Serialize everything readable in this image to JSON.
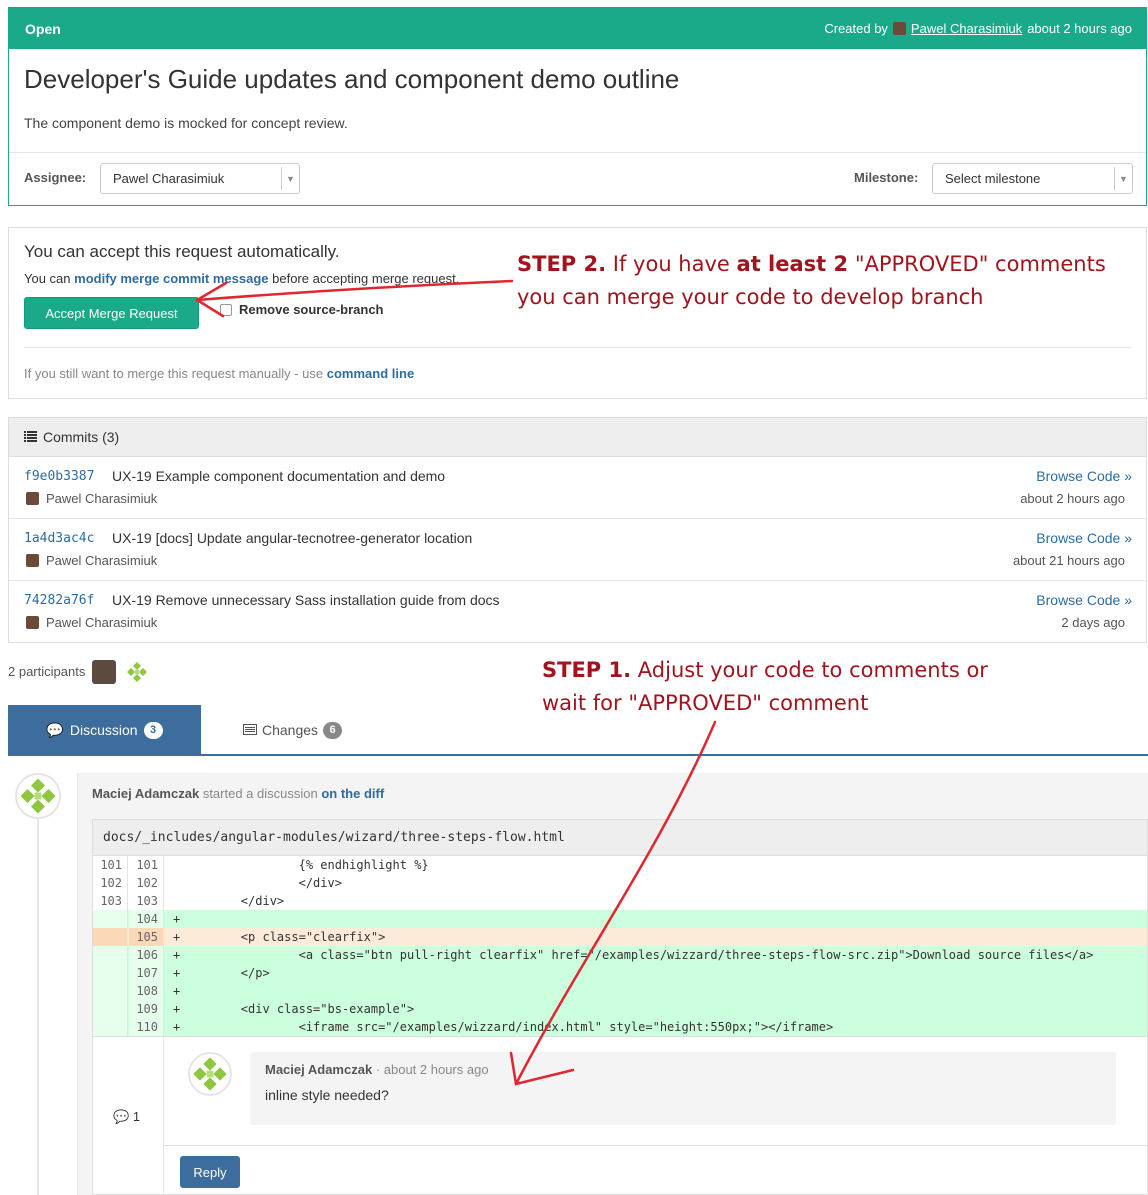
{
  "merge_request": {
    "state": "Open",
    "created_by_prefix": "Created by",
    "author": "Pawel Charasimiuk",
    "created_time": "about 2 hours ago",
    "title": "Developer's Guide updates and component demo outline",
    "description": "The component demo is mocked for concept review.",
    "assignee_label": "Assignee:",
    "assignee_value": "Pawel Charasimiuk",
    "milestone_label": "Milestone:",
    "milestone_value": "Select milestone"
  },
  "accept": {
    "title": "You can accept this request automatically.",
    "line_prefix": "You can",
    "line_link": "modify merge commit message",
    "line_suffix": "before accepting merge request.",
    "button": "Accept Merge Request",
    "remove_branch_label": "Remove source-branch",
    "manual_prefix": "If you still want to merge this request manually - use",
    "manual_link": "command line"
  },
  "commits": {
    "header": "Commits (3)",
    "items": [
      {
        "sha": "f9e0b3387",
        "message": "UX-19 Example component documentation and demo",
        "author": "Pawel Charasimiuk",
        "browse": "Browse Code »",
        "time": "about 2 hours ago"
      },
      {
        "sha": "1a4d3ac4c",
        "message": "UX-19 [docs] Update angular-tecnotree-generator location",
        "author": "Pawel Charasimiuk",
        "browse": "Browse Code »",
        "time": "about 21 hours ago"
      },
      {
        "sha": "74282a76f",
        "message": "UX-19 Remove unnecessary Sass installation guide from docs",
        "author": "Pawel Charasimiuk",
        "browse": "Browse Code »",
        "time": "2 days ago"
      }
    ]
  },
  "participants": "2 participants",
  "tabs": {
    "discussion_label": "Discussion",
    "discussion_count": "3",
    "changes_label": "Changes",
    "changes_count": "6"
  },
  "discussion": {
    "author": "Maciej Adamczak",
    "action": "started a discussion",
    "link": "on the diff",
    "file": "docs/_includes/angular-modules/wizard/three-steps-flow.html",
    "lines": [
      {
        "old": "101",
        "new": "101",
        "sign": "",
        "text": "                {% endhighlight %}",
        "kind": "ctx"
      },
      {
        "old": "102",
        "new": "102",
        "sign": "",
        "text": "                </div>",
        "kind": "ctx"
      },
      {
        "old": "103",
        "new": "103",
        "sign": "",
        "text": "        </div>",
        "kind": "ctx"
      },
      {
        "old": "",
        "new": "104",
        "sign": "+",
        "text": "",
        "kind": "add"
      },
      {
        "old": "",
        "new": "105",
        "sign": "+",
        "text": "        <p class=\"clearfix\">",
        "kind": "hl"
      },
      {
        "old": "",
        "new": "106",
        "sign": "+",
        "text": "                <a class=\"btn pull-right clearfix\" href=\"/examples/wizzard/three-steps-flow-src.zip\">Download source files</a>",
        "kind": "add"
      },
      {
        "old": "",
        "new": "107",
        "sign": "+",
        "text": "        </p>",
        "kind": "add"
      },
      {
        "old": "",
        "new": "108",
        "sign": "+",
        "text": "",
        "kind": "add"
      },
      {
        "old": "",
        "new": "109",
        "sign": "+",
        "text": "        <div class=\"bs-example\">",
        "kind": "add"
      },
      {
        "old": "",
        "new": "110",
        "sign": "+",
        "text": "                <iframe src=\"/examples/wizzard/index.html\" style=\"height:550px;\"></iframe>",
        "kind": "add"
      }
    ],
    "note_count": "1",
    "note_author": "Maciej Adamczak",
    "note_time": "· about 2 hours ago",
    "note_text": "inline style needed?",
    "reply_button": "Reply"
  },
  "annotations": {
    "step2_lead": "STEP 2.",
    "step2_a": "If you have",
    "step2_bold": "at least 2",
    "step2_b": "\"APPROVED\" comments",
    "step2_line2": "you can merge your code to develop branch",
    "step1_lead": "STEP 1.",
    "step1_a": "Adjust your code to comments or",
    "step1_line2": "wait for \"APPROVED\" comment",
    "color": "#a0141e"
  },
  "colors": {
    "accent_green": "#1aaa8a",
    "tab_blue": "#3c6d9c",
    "diff_add": "#ccffdd",
    "diff_highlight": "#fdebd9"
  }
}
